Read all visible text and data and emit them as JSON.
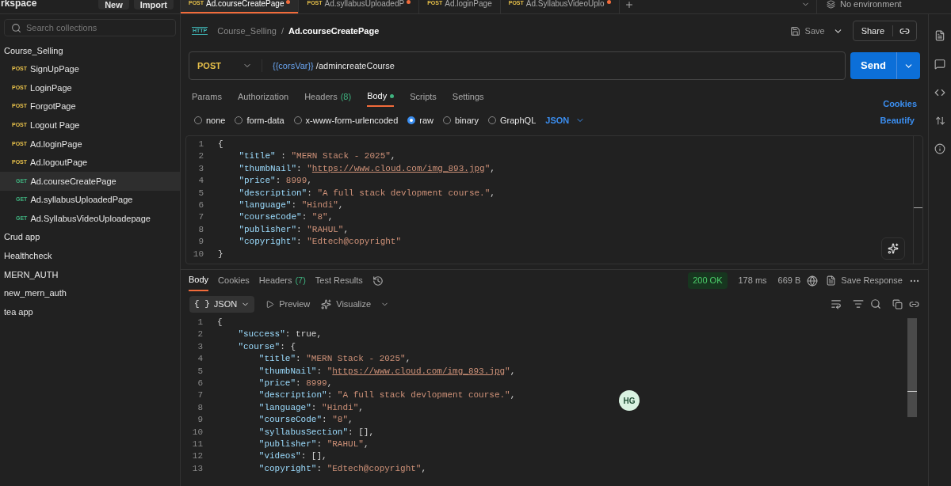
{
  "workspace": {
    "title": "rkspace",
    "buttons": [
      "New",
      "Import"
    ]
  },
  "tabs": [
    {
      "method": "POST",
      "label": "Ad.courseCreatePage",
      "selected": true,
      "unsaved": true
    },
    {
      "method": "POST",
      "label": "Ad.syllabusUploadedP",
      "selected": false,
      "unsaved": true
    },
    {
      "method": "POST",
      "label": "Ad.loginPage",
      "selected": false,
      "unsaved": false
    },
    {
      "method": "POST",
      "label": "Ad.SyllabusVideoUplo",
      "selected": false,
      "unsaved": true
    }
  ],
  "environment": "No environment",
  "sidebar": {
    "search": {
      "placeholder": "Search collections"
    },
    "items": [
      {
        "label": "Course_Selling",
        "children": [
          {
            "method": "POST",
            "label": "SignUpPage",
            "selected": false
          },
          {
            "method": "POST",
            "label": "LoginPage",
            "selected": false
          },
          {
            "method": "POST",
            "label": "ForgotPage",
            "selected": false
          },
          {
            "method": "POST",
            "label": "Logout Page",
            "selected": false
          },
          {
            "method": "POST",
            "label": "Ad.loginPage",
            "selected": false
          },
          {
            "method": "POST",
            "label": "Ad.logoutPage",
            "selected": false
          },
          {
            "method": "GET",
            "label": "Ad.courseCreatePage",
            "selected": true
          },
          {
            "method": "GET",
            "label": "Ad.syllabusUploadedPage",
            "selected": false
          },
          {
            "method": "GET",
            "label": "Ad.SyllabusVideoUploadepage",
            "selected": false
          }
        ]
      },
      {
        "label": "Crud app"
      },
      {
        "label": "Healthcheck"
      },
      {
        "label": "MERN_AUTH"
      },
      {
        "label": "new_mern_auth"
      },
      {
        "label": "tea app"
      }
    ]
  },
  "breadcrumb": {
    "protocol": "HTTP",
    "collection": "Course_Selling",
    "separator": "/",
    "request": "Ad.courseCreatePage"
  },
  "actions": {
    "save": "Save",
    "share": "Share"
  },
  "request": {
    "method": "POST",
    "variable": "{{corsVar}}",
    "path": "/admincreateCourse",
    "send": "Send"
  },
  "request_tabs": [
    {
      "label": "Params",
      "selected": false
    },
    {
      "label": "Authorization",
      "selected": false
    },
    {
      "label": "Headers",
      "count": "(8)",
      "selected": false
    },
    {
      "label": "Body",
      "selected": true,
      "dot": true
    },
    {
      "label": "Scripts",
      "selected": false
    },
    {
      "label": "Settings",
      "selected": false
    }
  ],
  "cookies": "Cookies",
  "beautify": "Beautify",
  "body_types": [
    {
      "label": "none",
      "selected": false
    },
    {
      "label": "form-data",
      "selected": false
    },
    {
      "label": "x-www-form-urlencoded",
      "selected": false
    },
    {
      "label": "raw",
      "selected": true
    },
    {
      "label": "binary",
      "selected": false
    },
    {
      "label": "GraphQL",
      "selected": false
    }
  ],
  "body_format": "JSON",
  "request_body": [
    {
      "n": "1",
      "text": "{"
    },
    {
      "n": "2",
      "text": "    \"title\" : \"MERN Stack - 2025\","
    },
    {
      "n": "3",
      "text": "    \"thumbNail\": \"https://www.cloud.com/img_893.jpg\","
    },
    {
      "n": "4",
      "text": "    \"price\": 8999,"
    },
    {
      "n": "5",
      "text": "    \"description\": \"A full stack devlopment course.\","
    },
    {
      "n": "6",
      "text": "    \"language\": \"Hindi\","
    },
    {
      "n": "7",
      "text": "    \"courseCode\": \"8\","
    },
    {
      "n": "8",
      "text": "    \"publisher\": \"RAHUL\","
    },
    {
      "n": "9",
      "text": "    \"copyright\": \"Edtech@copyright\""
    },
    {
      "n": "10",
      "text": "}"
    }
  ],
  "response_tabs": [
    {
      "label": "Body",
      "selected": true
    },
    {
      "label": "Cookies",
      "selected": false
    },
    {
      "label": "Headers",
      "count": "(7)",
      "selected": false
    },
    {
      "label": "Test Results",
      "selected": false
    }
  ],
  "response_meta": {
    "status": "200 OK",
    "time": "178 ms",
    "size": "669 B",
    "save": "Save Response"
  },
  "response_view": {
    "braces": "{ }",
    "format": "JSON",
    "preview": "Preview",
    "visualize": "Visualize"
  },
  "response_body": [
    {
      "n": "1",
      "text": "{"
    },
    {
      "n": "2",
      "text": "    \"success\": true,"
    },
    {
      "n": "3",
      "text": "    \"course\": {"
    },
    {
      "n": "4",
      "text": "        \"title\": \"MERN Stack - 2025\","
    },
    {
      "n": "5",
      "text": "        \"thumbNail\": \"https://www.cloud.com/img_893.jpg\","
    },
    {
      "n": "6",
      "text": "        \"price\": 8999,"
    },
    {
      "n": "7",
      "text": "        \"description\": \"A full stack devlopment course.\","
    },
    {
      "n": "8",
      "text": "        \"language\": \"Hindi\","
    },
    {
      "n": "9",
      "text": "        \"courseCode\": \"8\","
    },
    {
      "n": "10",
      "text": "        \"syllabusSection\": [],"
    },
    {
      "n": "11",
      "text": "        \"publisher\": \"RAHUL\","
    },
    {
      "n": "12",
      "text": "        \"videos\": [],"
    },
    {
      "n": "13",
      "text": "        \"copyright\": \"Edtech@copyright\","
    }
  ],
  "avatar": "HG"
}
